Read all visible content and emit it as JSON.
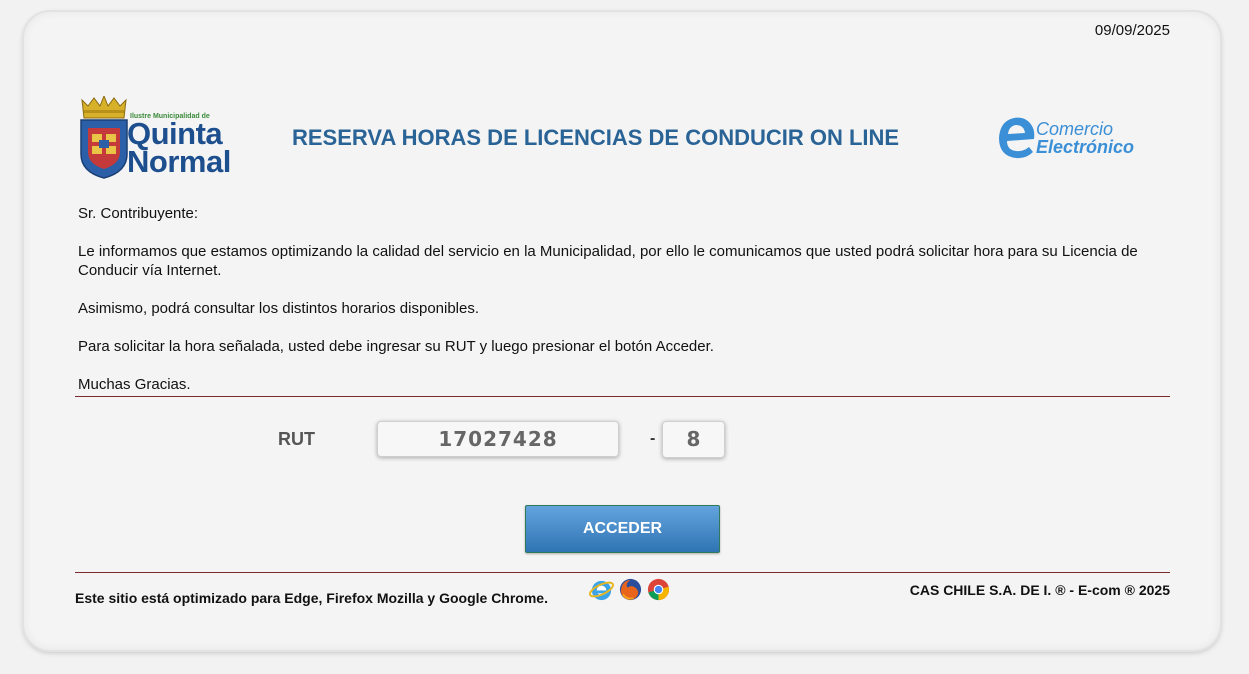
{
  "header": {
    "date": "09/09/2025",
    "title": "RESERVA HORAS DE LICENCIAS DE CONDUCIR ON LINE",
    "logo_left": {
      "small_text": "Ilustre Municipalidad de",
      "line1": "Quinta",
      "line2": "Normal"
    },
    "logo_right": {
      "line1": "Comercio",
      "line2": "Electrónico"
    }
  },
  "message": {
    "greeting": "Sr. Contribuyente:",
    "paragraph1": "Le informamos que estamos optimizando la calidad del servicio en la Municipalidad, por ello le comunicamos que usted podrá solicitar hora para su Licencia de Conducir vía Internet.",
    "paragraph2": "Asimismo, podrá consultar los distintos horarios disponibles.",
    "paragraph3": "Para solicitar la hora señalada, usted debe ingresar su RUT y luego presionar el botón Acceder.",
    "closing": "Muchas Gracias."
  },
  "form": {
    "rut_label": "RUT",
    "rut_value": "17027428",
    "separator": "-",
    "dv_value": "8",
    "submit_label": "ACCEDER"
  },
  "footer": {
    "browsers_note": "Este sitio está optimizado para Edge, Firefox Mozilla y Google Chrome.",
    "browser_icons": [
      "edge-icon",
      "firefox-icon",
      "chrome-icon"
    ],
    "copyright": "CAS CHILE S.A. DE I. ® - E-com ® 2025"
  },
  "colors": {
    "title": "#2a6396",
    "button_top": "#63a4dd",
    "button_bottom": "#2f74b3",
    "divider": "#7a2b2b"
  }
}
